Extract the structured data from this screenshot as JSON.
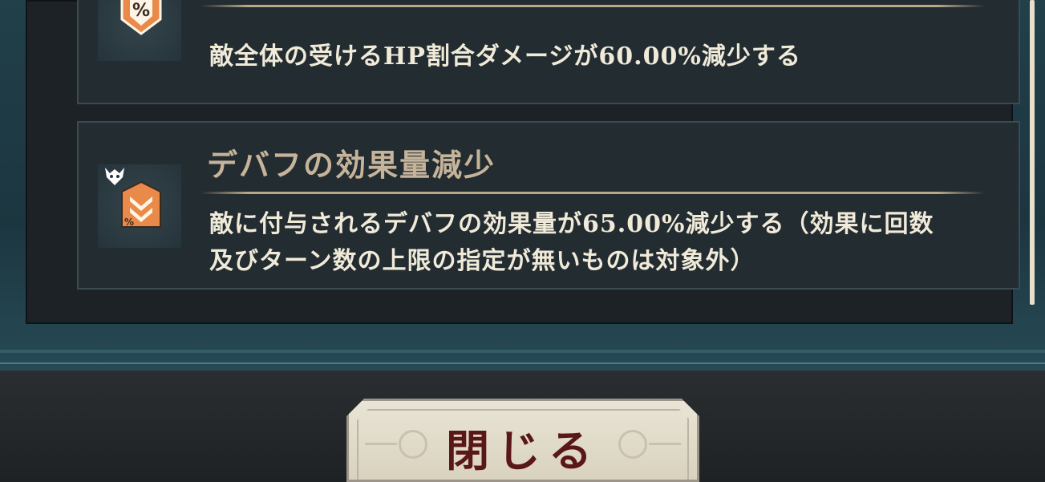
{
  "cards": [
    {
      "title": "",
      "description": "敵全体の受けるHP割合ダメージが60.00%減少する",
      "icon": "percent-shield-icon"
    },
    {
      "title": "デバフの効果量減少",
      "description_line1": "敵に付与されるデバフの効果量が65.00%減少する（効果に回数",
      "description_line2": "及びターン数の上限の指定が無いものは対象外）",
      "icon": "percent-debuff-down-icon",
      "badge_icon": "demon-crest-icon"
    }
  ],
  "close_button": {
    "label": "閉じる"
  },
  "colors": {
    "accent": "#e98a4a",
    "title": "#c6b49a",
    "text": "#f0ead9",
    "button_text": "#5a1717"
  }
}
